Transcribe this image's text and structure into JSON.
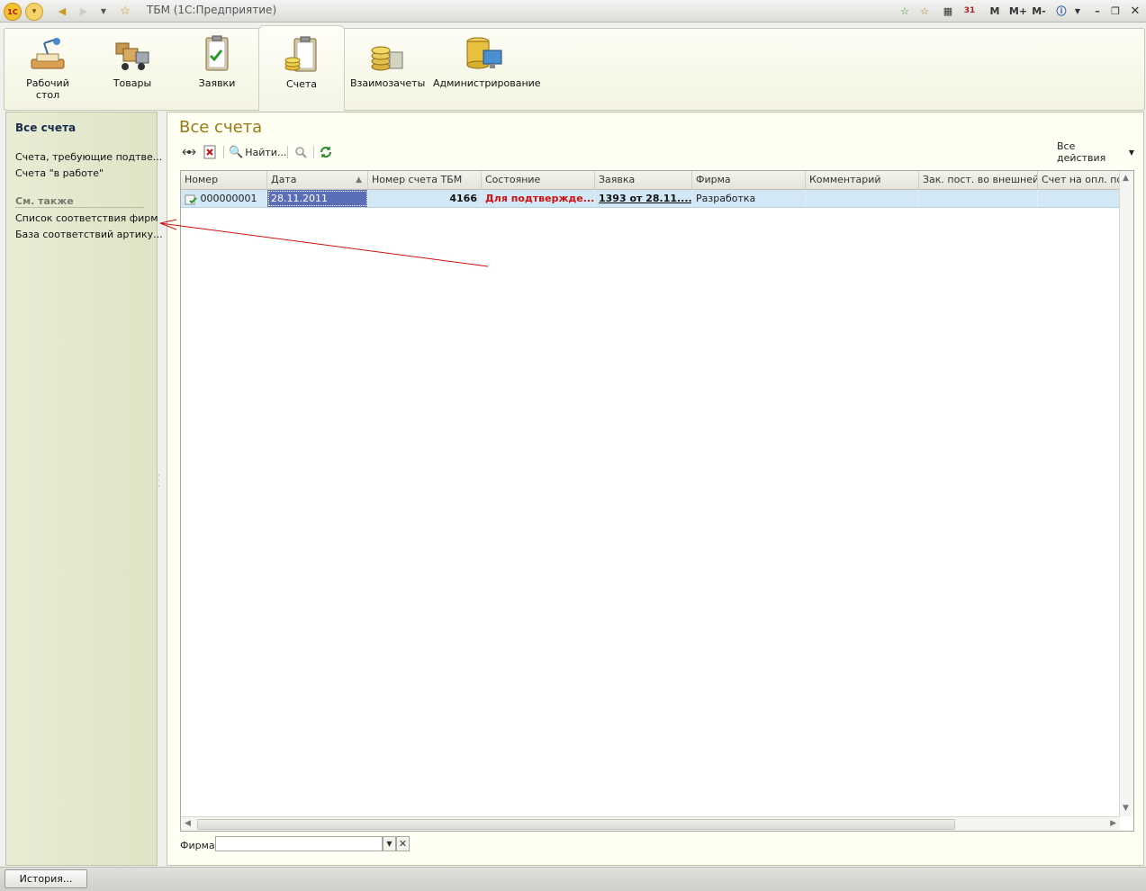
{
  "window": {
    "title": "ТБМ  (1С:Предприятие)",
    "right_tools": [
      "M",
      "M+",
      "M-"
    ]
  },
  "sections": [
    {
      "label": "Рабочий стол",
      "icon": "desk-lamp-icon"
    },
    {
      "label": "Товары",
      "icon": "truck-boxes-icon"
    },
    {
      "label": "Заявки",
      "icon": "clipboard-check-icon"
    },
    {
      "label": "Счета",
      "icon": "clipboard-coins-icon",
      "active": true
    },
    {
      "label": "Взаимозачеты",
      "icon": "coins-stack-icon"
    },
    {
      "label": "Администрирование",
      "icon": "database-monitor-icon"
    }
  ],
  "nav": {
    "current": "Все счета",
    "links": [
      "Счета, требующие подтве...",
      "Счета \"в работе\""
    ],
    "see_also_header": "См. также",
    "see_also": [
      "Список соответствия фирм",
      "База соответствий артику..."
    ]
  },
  "form": {
    "title": "Все счета",
    "find_label": "Найти...",
    "all_actions": "Все действия"
  },
  "table": {
    "columns": [
      "Номер",
      "Дата",
      "Номер счета ТБМ",
      "Состояние",
      "Заявка",
      "Фирма",
      "Комментарий",
      "Зак. пост. во внешней...",
      "Счет на опл. пост..."
    ],
    "rows": [
      {
        "number": "000000001",
        "date": "28.11.2011",
        "tbm_number": "4166",
        "state": "Для подтвержде...",
        "request": "1393 от 28.11....",
        "firm": "Разработка",
        "comment": "",
        "ext_order": "",
        "supplier_invoice": ""
      }
    ]
  },
  "filter": {
    "firm_label": "Фирма:",
    "firm_value": ""
  },
  "statusbar": {
    "history_button": "История..."
  },
  "colors": {
    "accent_title": "#9a7a10",
    "state_text": "#d01010",
    "selected_row": "#d2e8f6",
    "selected_cell": "#5b6fb8",
    "annotation_arrow": "#cc1010"
  }
}
